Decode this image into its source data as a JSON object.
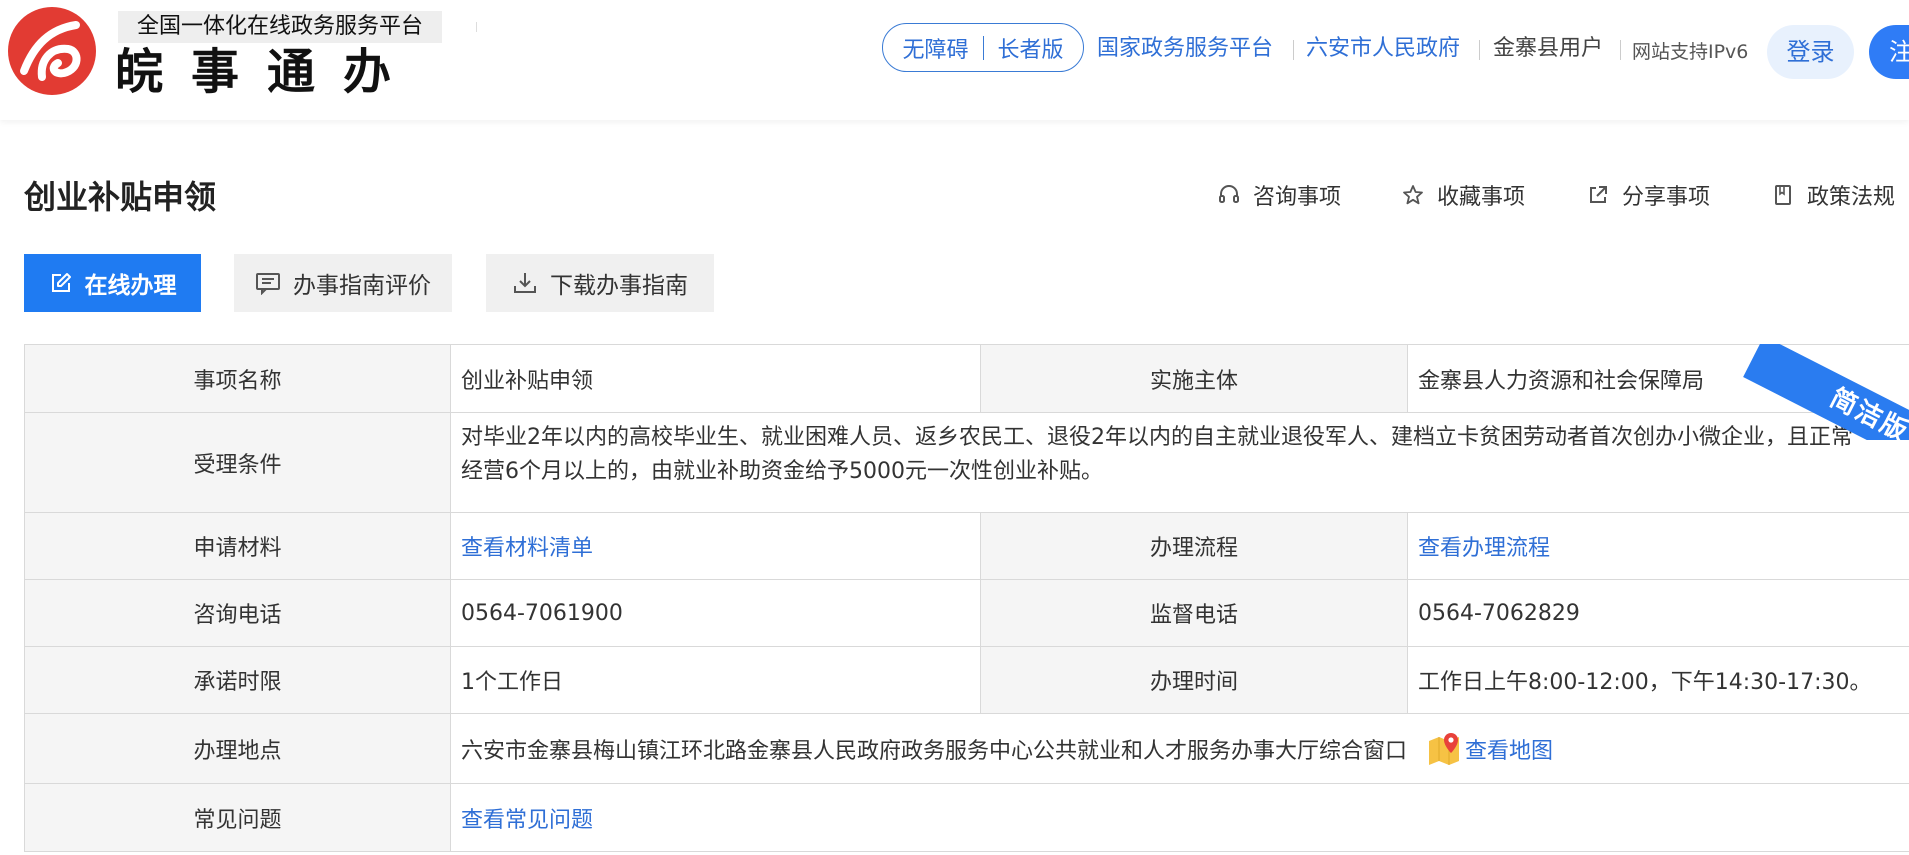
{
  "header": {
    "platform_subtitle": "全国一体化在线政务服务平台",
    "app_title": "皖事通办",
    "accessibility": "无障碍",
    "elder_mode": "长者版",
    "nav": {
      "national_platform": "国家政务服务平台",
      "city_gov": "六安市人民政府",
      "county_user": "金寨县用户",
      "ipv6": "网站支持IPv6"
    },
    "login": "登录",
    "register": "注册"
  },
  "page": {
    "title": "创业补贴申领",
    "actions": {
      "consult": "咨询事项",
      "favorite": "收藏事项",
      "share": "分享事项",
      "policy": "政策法规"
    },
    "buttons": {
      "online": "在线办理",
      "review": "办事指南评价",
      "download": "下载办事指南"
    },
    "ribbon": "简洁版"
  },
  "table": {
    "item_name_label": "事项名称",
    "item_name": "创业补贴申领",
    "executor_label": "实施主体",
    "executor": "金寨县人力资源和社会保障局",
    "conditions_label": "受理条件",
    "conditions_line1": "对毕业2年以内的高校毕业生、就业困难人员、返乡农民工、退役2年以内的自主就业退役军人、建档立卡贫困劳动者首次创办小微企业，且正常",
    "conditions_line2": "经营6个月以上的，由就业补助资金给予5000元一次性创业补贴。",
    "materials_label": "申请材料",
    "materials_link": "查看材料清单",
    "process_label": "办理流程",
    "process_link": "查看办理流程",
    "consult_phone_label": "咨询电话",
    "consult_phone": "0564-7061900",
    "supervise_phone_label": "监督电话",
    "supervise_phone": "0564-7062829",
    "deadline_label": "承诺时限",
    "deadline": "1个工作日",
    "hours_label": "办理时间",
    "hours": "工作日上午8:00-12:00，下午14:30-17:30。",
    "location_label": "办理地点",
    "location": "六安市金寨县梅山镇江环北路金寨县人民政府政务服务中心公共就业和人才服务办事大厅综合窗口",
    "map_link": "查看地图",
    "faq_label": "常见问题",
    "faq_link": "查看常见问题"
  }
}
